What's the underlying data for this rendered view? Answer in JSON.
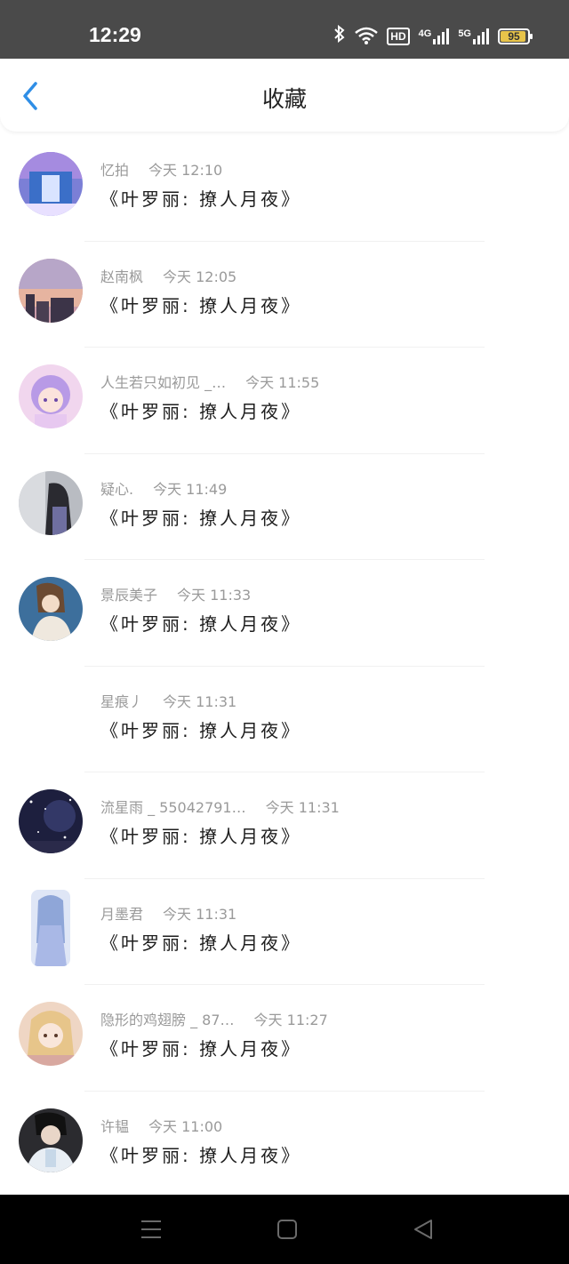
{
  "status_bar": {
    "time": "12:29",
    "hd_label": "HD",
    "net1_label": "4G",
    "net2_label": "5G",
    "battery_level": "95",
    "battery_percent": 95
  },
  "header": {
    "title": "收藏",
    "back_icon": "chevron-left-icon",
    "accent_color": "#2f8ee6"
  },
  "favorites": [
    {
      "user": "忆拍",
      "time": "今天 12:10",
      "title": "《叶罗丽: 撩人月夜》"
    },
    {
      "user": "赵南枫",
      "time": "今天 12:05",
      "title": "《叶罗丽: 撩人月夜》"
    },
    {
      "user": "人生若只如初见 _…",
      "time": "今天 11:55",
      "title": "《叶罗丽: 撩人月夜》"
    },
    {
      "user": "疑心.",
      "time": "今天 11:49",
      "title": "《叶罗丽: 撩人月夜》"
    },
    {
      "user": "景辰美子",
      "time": "今天 11:33",
      "title": "《叶罗丽: 撩人月夜》"
    },
    {
      "user": "星痕丿",
      "time": "今天 11:31",
      "title": "《叶罗丽: 撩人月夜》"
    },
    {
      "user": "流星雨 _ 55042791…",
      "time": "今天 11:31",
      "title": "《叶罗丽: 撩人月夜》"
    },
    {
      "user": "月墨君",
      "time": "今天 11:31",
      "title": "《叶罗丽: 撩人月夜》"
    },
    {
      "user": "隐形的鸡翅膀 _ 87…",
      "time": "今天 11:27",
      "title": "《叶罗丽: 撩人月夜》"
    },
    {
      "user": "许韫",
      "time": "今天 11:00",
      "title": "《叶罗丽: 撩人月夜》"
    }
  ],
  "nav_bar": {
    "menu_icon": "menu-icon",
    "home_icon": "home-square-icon",
    "back_icon": "back-triangle-icon"
  }
}
